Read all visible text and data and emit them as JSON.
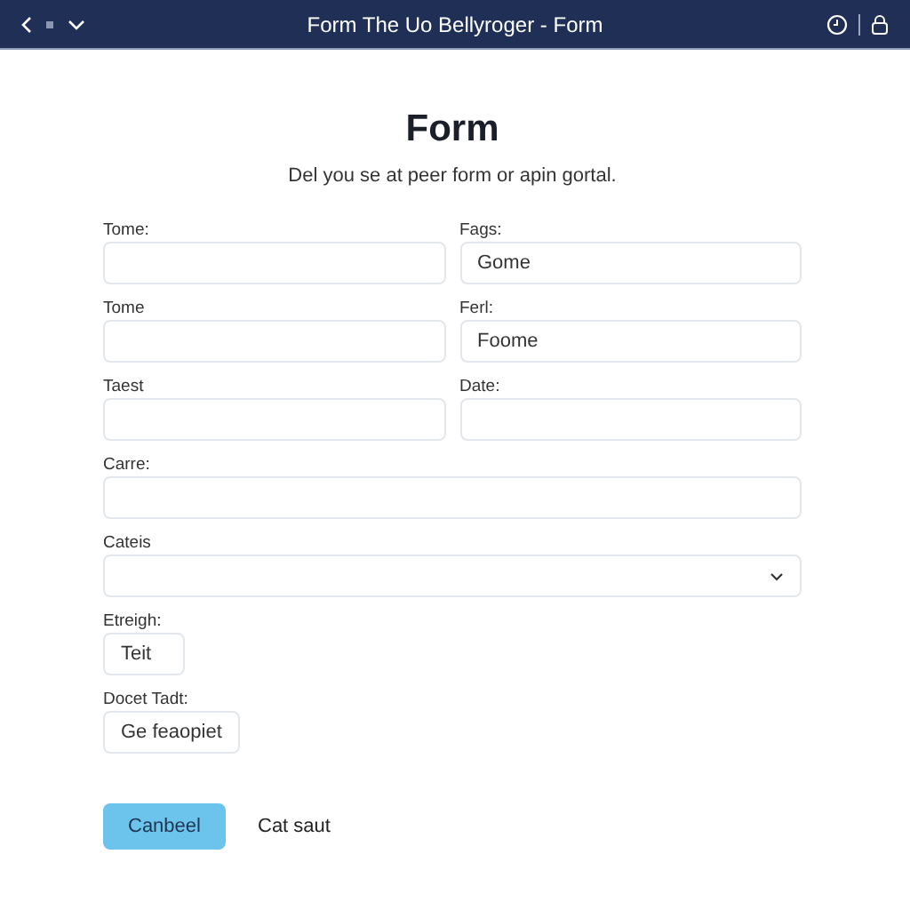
{
  "window": {
    "title": "Form  The Uo Bellyroger - Form"
  },
  "heading": "Form",
  "subtitle": "Del you se at peer form or apin gortal.",
  "rows": [
    [
      {
        "kind": "text",
        "label": "Tome:"
      },
      {
        "kind": "text",
        "label": "Fags:",
        "value": "Gome"
      }
    ],
    [
      {
        "kind": "text",
        "label": "Tome"
      },
      {
        "kind": "text",
        "label": "Ferl:",
        "value": "Foome"
      }
    ],
    [
      {
        "kind": "text",
        "label": "Taest"
      },
      {
        "kind": "text",
        "label": "Date:"
      }
    ],
    [
      {
        "kind": "text",
        "label": "Carre:"
      }
    ],
    [
      {
        "kind": "select",
        "label": "Cateis"
      }
    ],
    [
      {
        "kind": "short",
        "label": "Etreigh:",
        "value": "Teit"
      }
    ],
    [
      {
        "kind": "medium",
        "label": "Docet Tadt:",
        "value": "Ge feaopiet"
      }
    ]
  ],
  "buttons": {
    "primary": "Canbeel",
    "secondary": "Cat saut"
  }
}
